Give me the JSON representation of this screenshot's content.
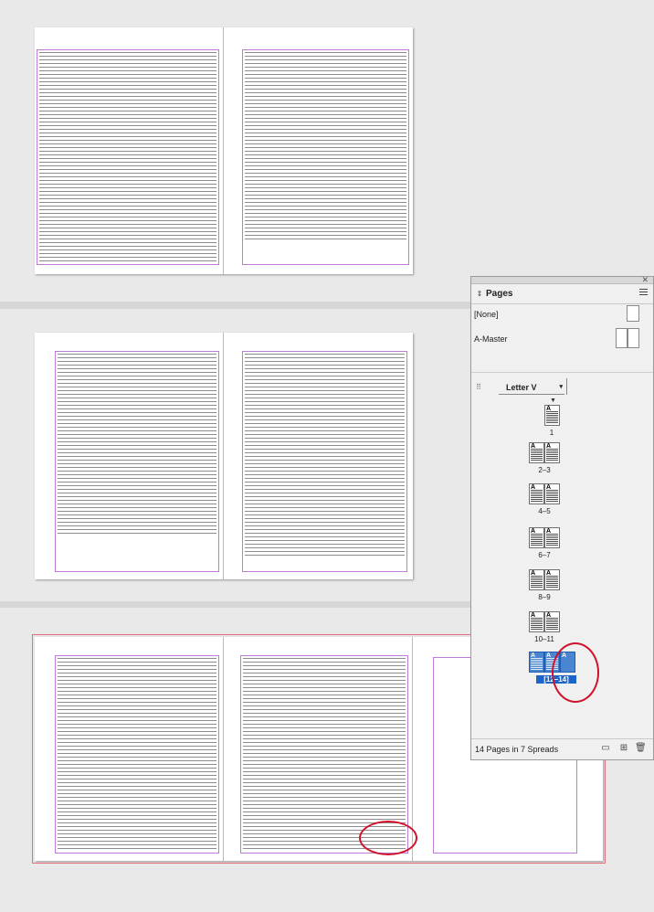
{
  "panel": {
    "title": "Pages",
    "tab_arrows": "⇕",
    "masters": [
      {
        "label": "[None]"
      },
      {
        "label": "A-Master"
      }
    ],
    "page_size": "Letter V",
    "spreads": [
      {
        "label": "1"
      },
      {
        "label": "2–3"
      },
      {
        "label": "4–5"
      },
      {
        "label": "6–7"
      },
      {
        "label": "8–9"
      },
      {
        "label": "10–11"
      },
      {
        "label": "[12–14]",
        "selected": true
      }
    ],
    "thumb_master_letter": "A",
    "footer_text": "14 Pages in 7 Spreads",
    "icons": [
      "page-size-icon",
      "new-page-icon",
      "trash-icon",
      "panel-menu-icon",
      "close-icon"
    ]
  },
  "colors": {
    "margin_guide": "#c07ad8",
    "bleed_guide": "#e26f7b",
    "selection": "#1c64c8",
    "annotation": "#d0122a"
  }
}
